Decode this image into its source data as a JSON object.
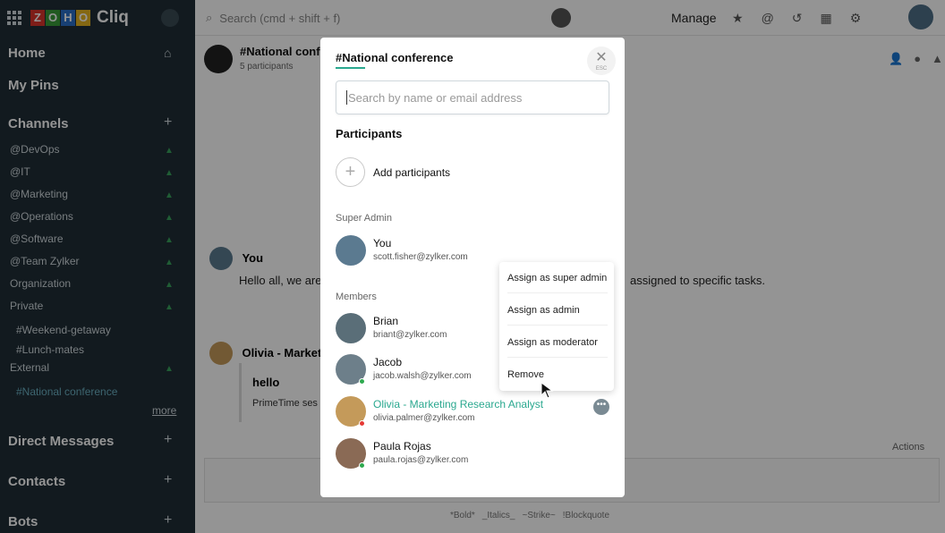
{
  "app": {
    "brand_letters": [
      "Z",
      "O",
      "H",
      "O"
    ],
    "name": "Cliq"
  },
  "topbar": {
    "search_placeholder": "Search (cmd + shift + f)",
    "manage_label": "Manage"
  },
  "sidebar": {
    "home": "Home",
    "my_pins": "My Pins",
    "channels_heading": "Channels",
    "channels": [
      "@DevOps",
      "@IT",
      "@Marketing",
      "@Operations",
      "@Software",
      "@Team Zylker",
      "Organization",
      "Private"
    ],
    "private_subs": [
      "#Weekend-getaway",
      "#Lunch-mates"
    ],
    "external": "External",
    "external_sub": "#National conference",
    "more": "more",
    "direct_messages": "Direct Messages",
    "contacts": "Contacts",
    "bots": "Bots"
  },
  "chat": {
    "title": "#National confer",
    "participants_count": "5 participants",
    "you_name": "You",
    "you_message_start": "Hello all, we are",
    "you_message_end": "assigned to specific tasks.",
    "olivia_name": "Olivia - Marketi",
    "card_title": "hello",
    "card_text": "PrimeTime ses",
    "actions_label": "Actions",
    "format_hint": [
      "*Bold*",
      "_Italics_",
      "~Strike~",
      "!Blockquote"
    ]
  },
  "modal": {
    "title": "#National conference",
    "close_label": "ESC",
    "search_placeholder": "Search by name or email address",
    "participants_heading": "Participants",
    "add_participants": "Add participants",
    "super_admin_label": "Super Admin",
    "members_label": "Members",
    "super_admin": {
      "name": "You",
      "email": "scott.fisher@zylker.com"
    },
    "members": [
      {
        "name": "Brian",
        "email": "briant@zylker.com",
        "status": "none",
        "avatar_color": "#5a6e78"
      },
      {
        "name": "Jacob",
        "email": "jacob.walsh@zylker.com",
        "status": "online",
        "avatar_color": "#6d7f8a"
      },
      {
        "name": "Olivia - Marketing Research  Analyst",
        "email": "olivia.palmer@zylker.com",
        "status": "busy",
        "avatar_color": "#c49a5a"
      },
      {
        "name": "Paula Rojas",
        "email": "paula.rojas@zylker.com",
        "status": "online",
        "avatar_color": "#8a6a55"
      }
    ]
  },
  "context_menu": {
    "items": [
      "Assign as super admin",
      "Assign as admin",
      "Assign as moderator",
      "Remove"
    ]
  },
  "colors": {
    "accent": "#2aa88f",
    "online": "#2eaa4f",
    "busy": "#e53935",
    "sidebar": "#1f2d36"
  }
}
